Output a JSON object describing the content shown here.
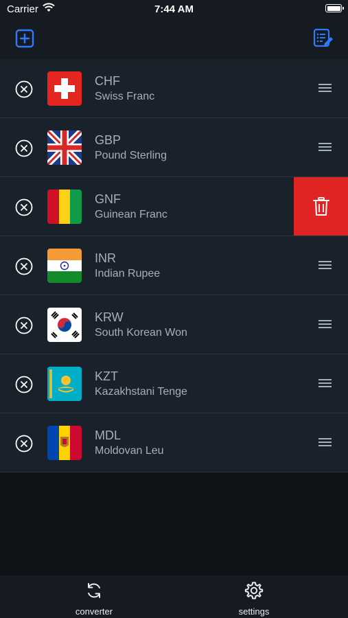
{
  "status_bar": {
    "carrier": "Carrier",
    "time": "7:44 AM"
  },
  "nav": {
    "add_icon": "plus-square-icon",
    "edit_icon": "list-edit-icon"
  },
  "currencies": [
    {
      "code": "CHF",
      "name": "Swiss Franc"
    },
    {
      "code": "GBP",
      "name": "Pound Sterling"
    },
    {
      "code": "GNF",
      "name": "Guinean Franc"
    },
    {
      "code": "INR",
      "name": "Indian Rupee"
    },
    {
      "code": "KRW",
      "name": "South Korean Won"
    },
    {
      "code": "KZT",
      "name": "Kazakhstani Tenge"
    },
    {
      "code": "MDL",
      "name": "Moldovan Leu"
    }
  ],
  "tabs": [
    {
      "label": "converter",
      "icon": "refresh-icon"
    },
    {
      "label": "settings",
      "icon": "gear-icon"
    }
  ],
  "colors": {
    "accent": "#2f7bff",
    "delete": "#e02424",
    "row_bg": "#19212a",
    "background": "#0f1318"
  }
}
